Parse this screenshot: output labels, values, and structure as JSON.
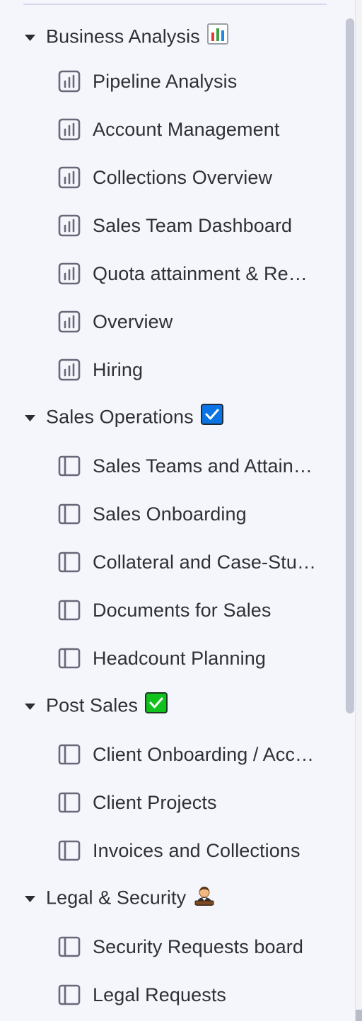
{
  "sections": [
    {
      "title": "Business Analysis",
      "emoji": "bar-chart-emoji",
      "expanded": true,
      "items": [
        {
          "label": "Pipeline Analysis",
          "icon": "bar-chart-icon"
        },
        {
          "label": "Account Management",
          "icon": "bar-chart-icon"
        },
        {
          "label": "Collections Overview",
          "icon": "bar-chart-icon"
        },
        {
          "label": "Sales Team Dashboard",
          "icon": "bar-chart-icon"
        },
        {
          "label": "Quota attainment & Rep…",
          "icon": "bar-chart-icon"
        },
        {
          "label": "Overview",
          "icon": "bar-chart-icon"
        },
        {
          "label": "Hiring",
          "icon": "bar-chart-icon"
        }
      ]
    },
    {
      "title": "Sales Operations",
      "emoji": "blue-checkbox-emoji",
      "expanded": true,
      "items": [
        {
          "label": "Sales Teams and Attain…",
          "icon": "board-icon"
        },
        {
          "label": "Sales Onboarding",
          "icon": "board-icon"
        },
        {
          "label": "Collateral and Case-Stu…",
          "icon": "board-icon"
        },
        {
          "label": "Documents for Sales",
          "icon": "board-icon"
        },
        {
          "label": "Headcount Planning",
          "icon": "board-icon"
        }
      ]
    },
    {
      "title": "Post Sales",
      "emoji": "green-check-emoji",
      "expanded": true,
      "items": [
        {
          "label": "Client Onboarding / Acc…",
          "icon": "board-icon"
        },
        {
          "label": "Client Projects",
          "icon": "board-icon"
        },
        {
          "label": "Invoices and Collections",
          "icon": "board-icon"
        }
      ]
    },
    {
      "title": "Legal & Security",
      "emoji": "judge-emoji",
      "expanded": true,
      "items": [
        {
          "label": "Security Requests board",
          "icon": "board-icon"
        },
        {
          "label": "Legal Requests",
          "icon": "board-icon"
        }
      ]
    }
  ],
  "colors": {
    "background": "#f5f6fb",
    "text": "#2f3037",
    "icon": "#676879",
    "scrollbar": "#c3c6d3",
    "blue_check": "#0073ea",
    "green_check": "#00c875"
  }
}
